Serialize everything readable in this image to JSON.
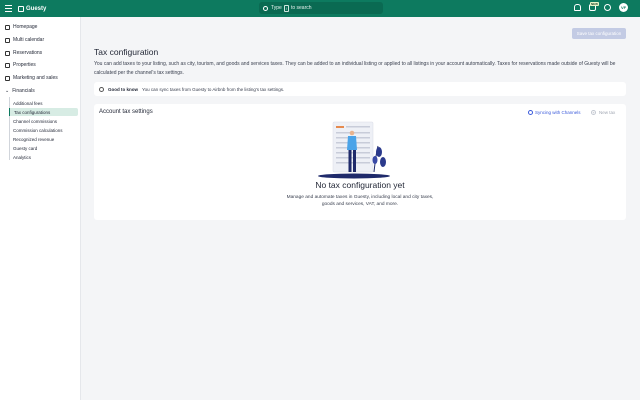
{
  "header": {
    "brand": "Guesty",
    "search_prefix": "Type",
    "search_key": "/",
    "search_suffix": "to search",
    "badge": "NEW",
    "avatar_initials": "VF"
  },
  "sidebar": {
    "items": [
      {
        "label": "Homepage"
      },
      {
        "label": "Multi calendar"
      },
      {
        "label": "Reservations"
      },
      {
        "label": "Properties"
      },
      {
        "label": "Marketing and sales"
      },
      {
        "label": "Financials"
      }
    ],
    "financials_sub": [
      {
        "label": "Additional fees"
      },
      {
        "label": "Tax configurations"
      },
      {
        "label": "Channel commissions"
      },
      {
        "label": "Commission calculations"
      },
      {
        "label": "Recognized revenue"
      },
      {
        "label": "Guesty card"
      },
      {
        "label": "Analytics"
      }
    ]
  },
  "main": {
    "title": "Tax configuration",
    "save_label": "Save tax configuration",
    "description": "You can add taxes to your listing, such as city, tourism, and goods and services taxes. They can be added to an individual listing or applied to all listings in your account automatically. Taxes for reservations made outside of Guesty will be calculated per the channel's tax settings.",
    "info_title": "Good to know",
    "info_text": "You can sync taxes from Guesty to Airbnb from the listing's tax settings.",
    "card_title": "Account tax settings",
    "sync_label": "Syncing with Channels",
    "new_tax_label": "New tax",
    "empty_title": "No tax configuration yet",
    "empty_desc": "Manage and automate taxes in Guesty, including local and city taxes, goods and services, VAT, and more."
  },
  "colors": {
    "brand": "#0d7a5f",
    "accent_link": "#3b5bdb",
    "button_disabled": "#c3cbe4",
    "active_nav": "#d7ece4"
  }
}
